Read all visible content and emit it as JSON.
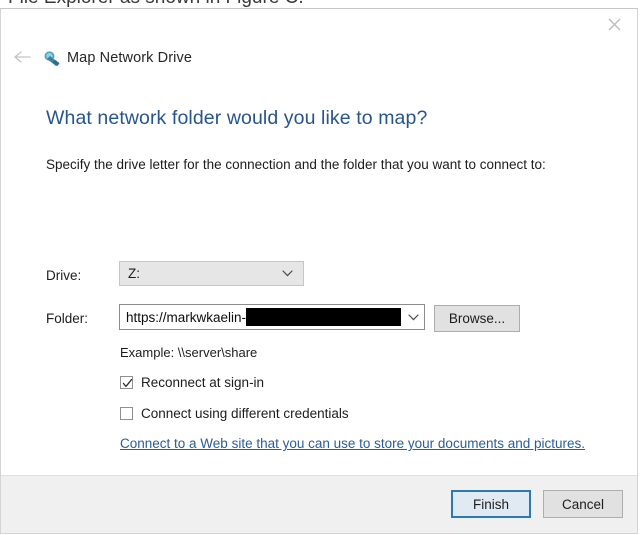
{
  "background_window": {
    "cut_off_text": "File Explorer as shown in Figure C."
  },
  "dialog": {
    "title": "Map Network Drive",
    "title_icon": "map-network-drive-icon",
    "back_icon": "back-arrow-icon",
    "close_icon": "close-icon",
    "heading": "What network folder would you like to map?",
    "instruction": "Specify the drive letter for the connection and the folder that you want to connect to:",
    "drive": {
      "label": "Drive:",
      "value": "Z:",
      "dropdown_icon": "chevron-down-icon"
    },
    "folder": {
      "label": "Folder:",
      "value": "https://markwkaelin-",
      "redacted": true,
      "dropdown_icon": "chevron-down-icon",
      "browse_label": "Browse..."
    },
    "example_text": "Example: \\\\server\\share",
    "checkboxes": [
      {
        "label": "Reconnect at sign-in",
        "checked": true
      },
      {
        "label": "Connect using different credentials",
        "checked": false
      }
    ],
    "link_text": "Connect to a Web site that you can use to store your documents and pictures.",
    "footer": {
      "finish_label": "Finish",
      "cancel_label": "Cancel"
    }
  },
  "colors": {
    "heading": "#27558c",
    "link": "#2b5c97",
    "default_button_border": "#2a7bb5",
    "footer_bg": "#f0f0f0",
    "redaction": "#000000"
  }
}
